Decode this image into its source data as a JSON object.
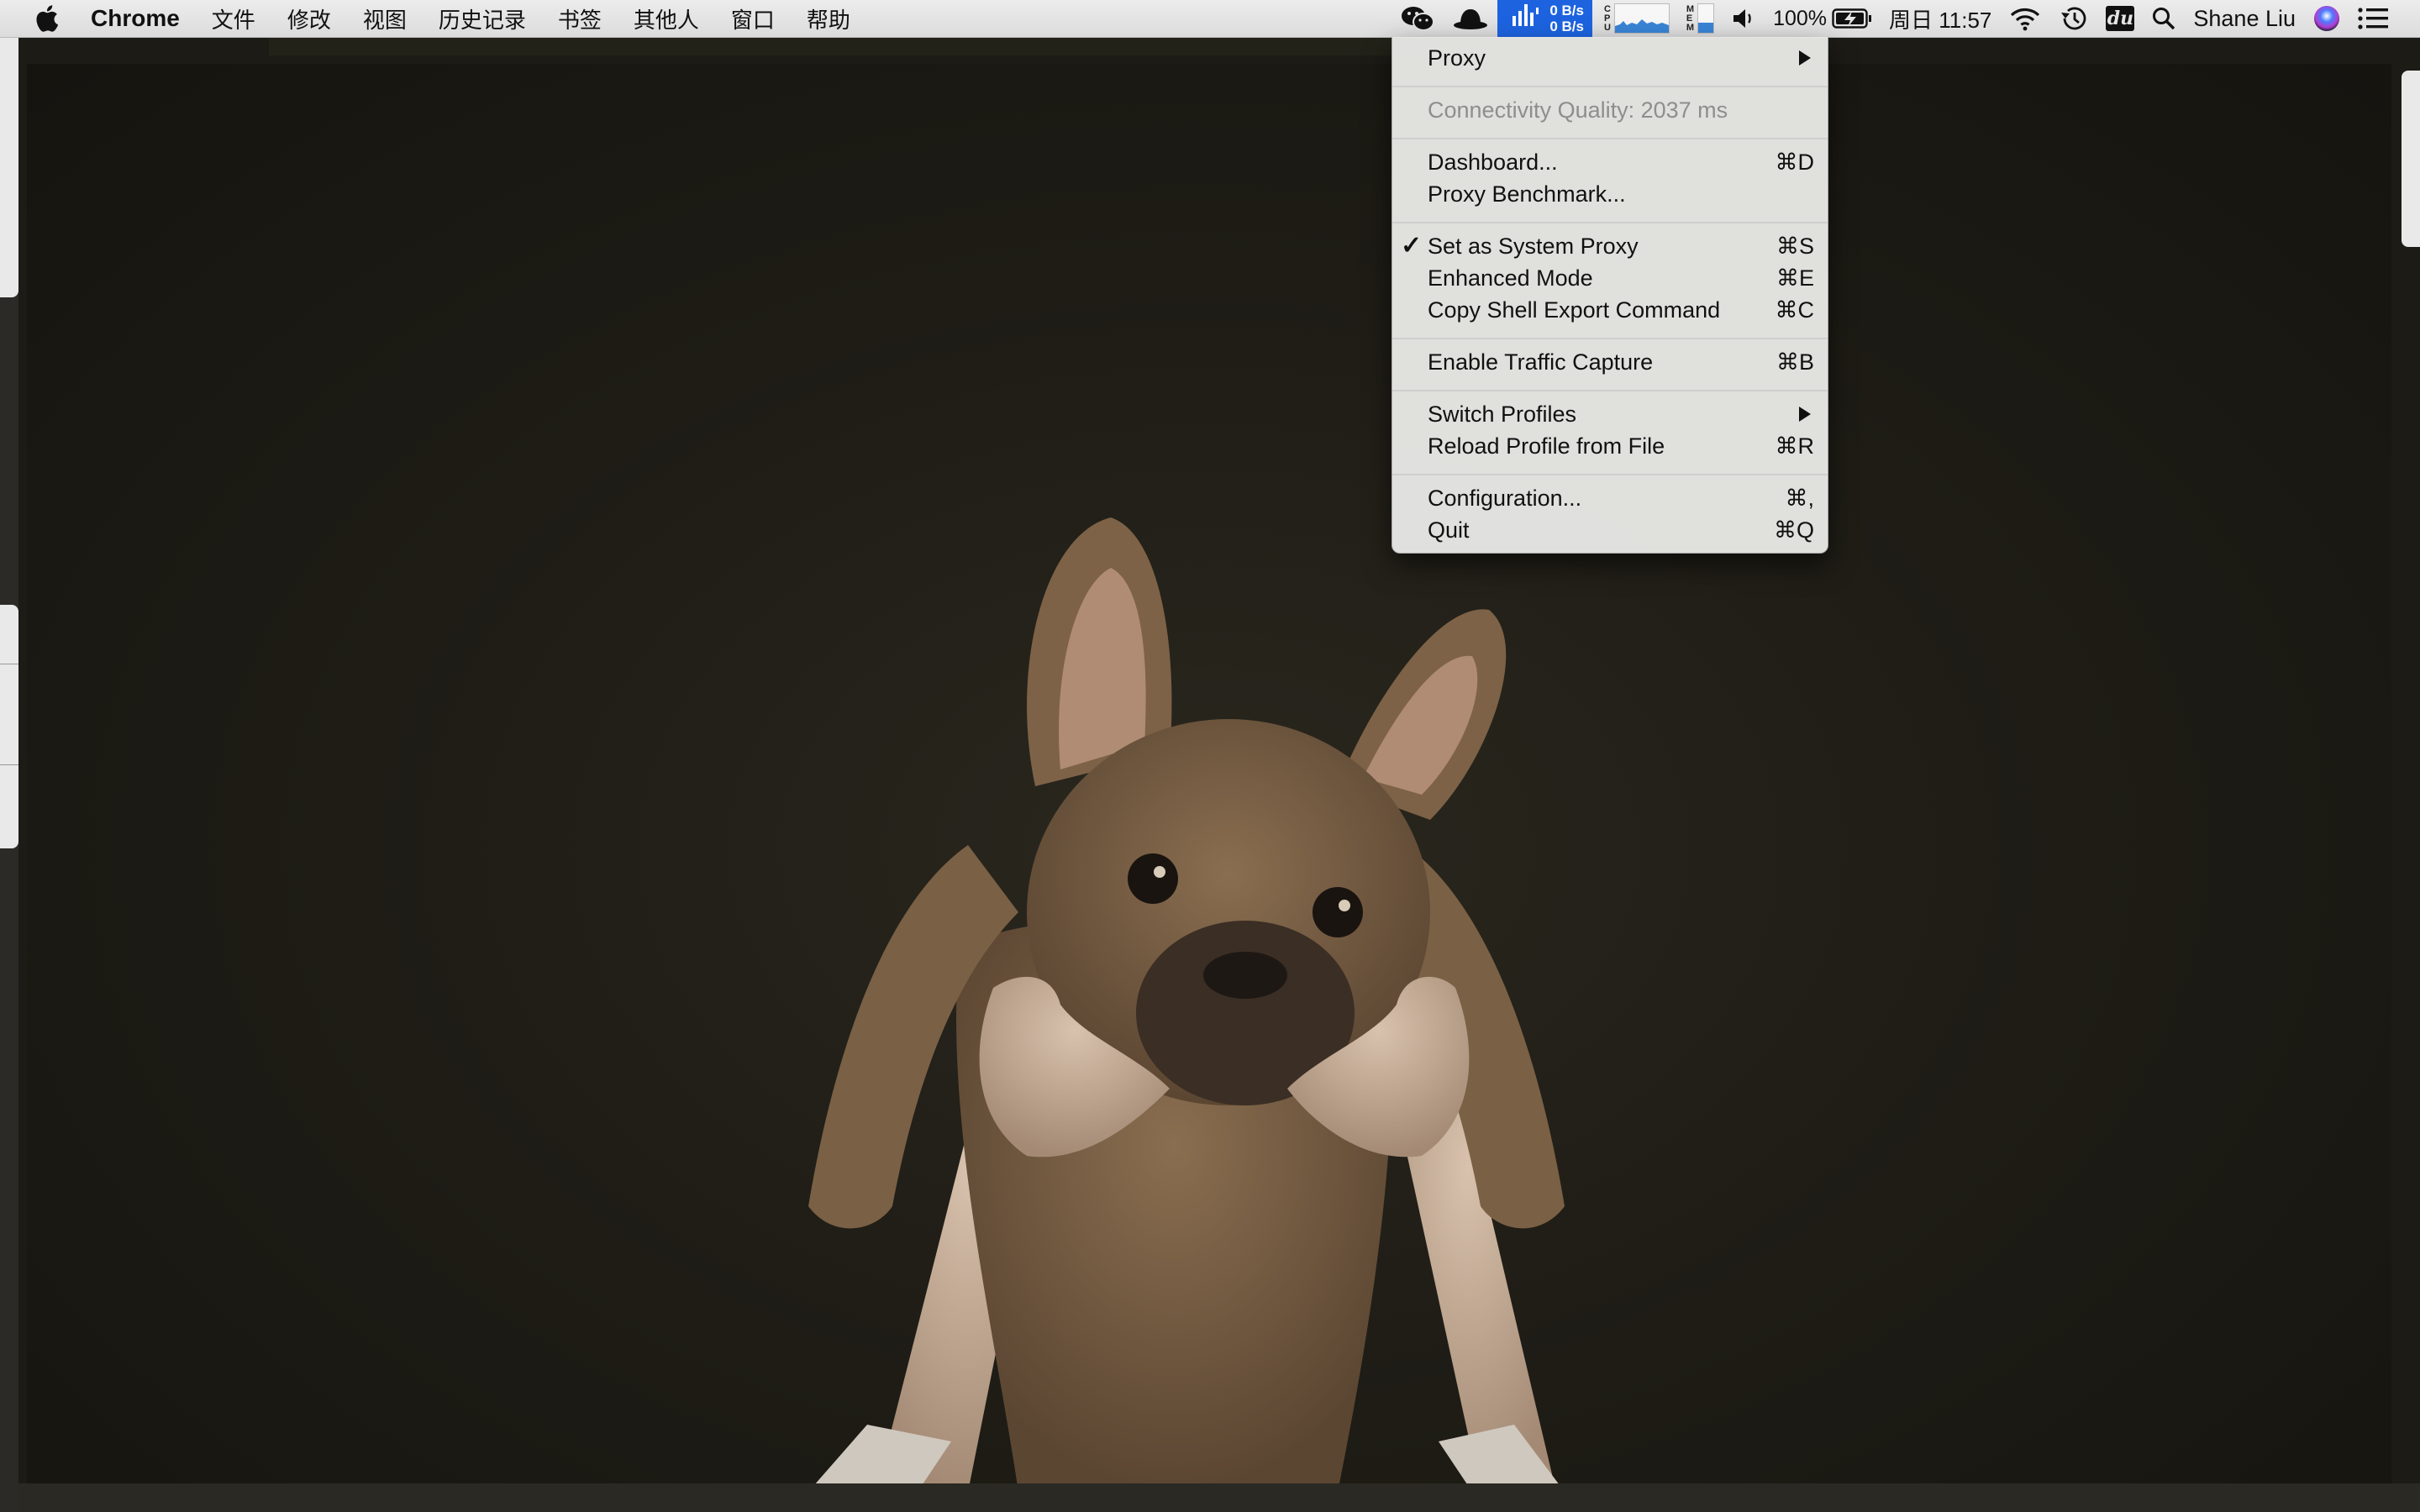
{
  "menubar": {
    "apple_icon": "apple-icon",
    "app_name": "Chrome",
    "menus": [
      "文件",
      "修改",
      "视图",
      "历史记录",
      "书签",
      "其他人",
      "窗口",
      "帮助"
    ],
    "status": {
      "upload_speed": "0 B/s",
      "download_speed": "0 B/s",
      "cpu_label": [
        "C",
        "P",
        "U"
      ],
      "mem_label": [
        "M",
        "E",
        "M"
      ],
      "battery_percent": "100%",
      "datetime": "周日 11:57",
      "user_name": "Shane Liu",
      "dict_label": "du"
    }
  },
  "dropdown": {
    "items": {
      "proxy": "Proxy",
      "connectivity": "Connectivity Quality: 2037 ms",
      "dashboard": "Dashboard...",
      "dashboard_sc": "⌘D",
      "benchmark": "Proxy Benchmark...",
      "system_proxy": "Set as System Proxy",
      "system_proxy_sc": "⌘S",
      "system_proxy_checked": true,
      "enhanced": "Enhanced Mode",
      "enhanced_sc": "⌘E",
      "copy_shell": "Copy Shell Export Command",
      "copy_shell_sc": "⌘C",
      "traffic": "Enable Traffic Capture",
      "traffic_sc": "⌘B",
      "switch_profiles": "Switch Profiles",
      "reload": "Reload Profile from File",
      "reload_sc": "⌘R",
      "configuration": "Configuration...",
      "configuration_sc": "⌘,",
      "quit": "Quit",
      "quit_sc": "⌘Q"
    },
    "checkmark": "✓"
  },
  "colors": {
    "menubar_bg": "#e6e6e6",
    "active_status_bg": "#1d63e0",
    "menu_bg": "#e8e8e6",
    "photo_bg": "#1f1d16"
  }
}
